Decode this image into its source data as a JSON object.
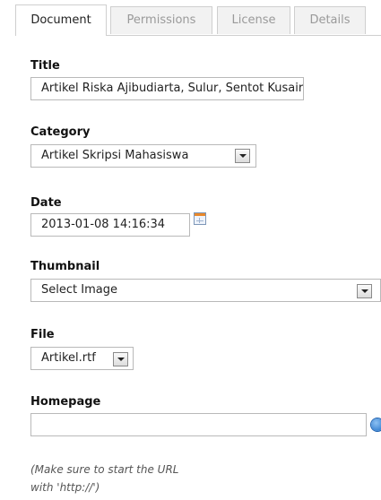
{
  "tabs": [
    {
      "label": "Document"
    },
    {
      "label": "Permissions"
    },
    {
      "label": "License"
    },
    {
      "label": "Details"
    }
  ],
  "form": {
    "title": {
      "label": "Title",
      "value": "Artikel Riska Ajibudiarta, Sulur, Sentot Kusairi"
    },
    "category": {
      "label": "Category",
      "value": "Artikel Skripsi Mahasiswa"
    },
    "date": {
      "label": "Date",
      "value": "2013-01-08 14:16:34"
    },
    "thumbnail": {
      "label": "Thumbnail",
      "value": "Select Image"
    },
    "file": {
      "label": "File",
      "value": "Artikel.rtf"
    },
    "homepage": {
      "label": "Homepage",
      "value": ""
    },
    "note_line1": "(Make sure to start the URL",
    "note_line2": "with 'http://')"
  },
  "icons": {
    "calendar": "calendar-icon",
    "help": "help-icon",
    "dropdown": "chevron-down-icon"
  }
}
